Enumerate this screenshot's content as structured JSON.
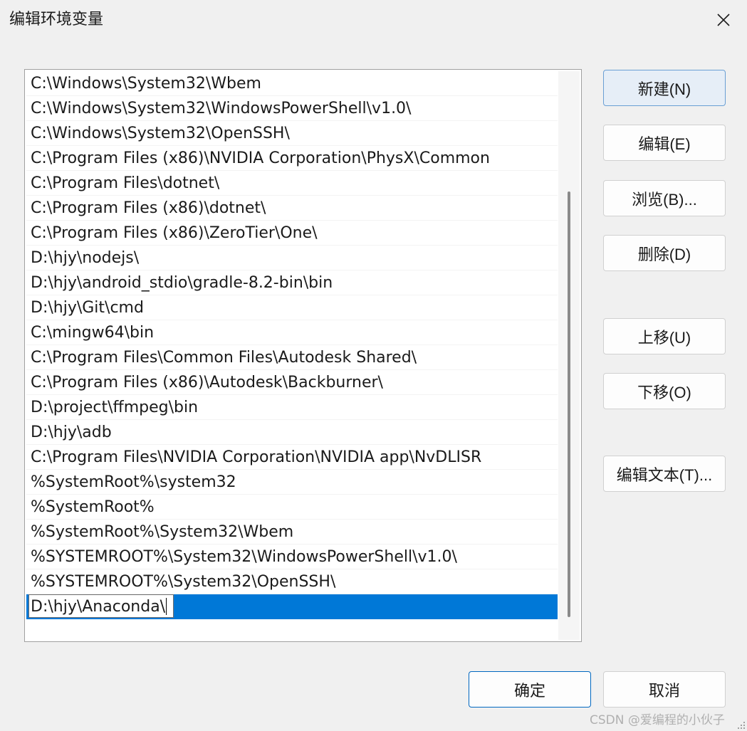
{
  "window": {
    "title": "编辑环境变量"
  },
  "paths": [
    "C:\\Windows\\System32\\Wbem",
    "C:\\Windows\\System32\\WindowsPowerShell\\v1.0\\",
    "C:\\Windows\\System32\\OpenSSH\\",
    "C:\\Program Files (x86)\\NVIDIA Corporation\\PhysX\\Common",
    "C:\\Program Files\\dotnet\\",
    "C:\\Program Files (x86)\\dotnet\\",
    "C:\\Program Files (x86)\\ZeroTier\\One\\",
    "D:\\hjy\\nodejs\\",
    "D:\\hjy\\android_stdio\\gradle-8.2-bin\\bin",
    "D:\\hjy\\Git\\cmd",
    "C:\\mingw64\\bin",
    "C:\\Program Files\\Common Files\\Autodesk Shared\\",
    "C:\\Program Files (x86)\\Autodesk\\Backburner\\",
    "D:\\project\\ffmpeg\\bin",
    "D:\\hjy\\adb",
    "C:\\Program Files\\NVIDIA Corporation\\NVIDIA app\\NvDLISR",
    "%SystemRoot%\\system32",
    "%SystemRoot%",
    "%SystemRoot%\\System32\\Wbem",
    "%SYSTEMROOT%\\System32\\WindowsPowerShell\\v1.0\\",
    "%SYSTEMROOT%\\System32\\OpenSSH\\"
  ],
  "editing": {
    "value": "D:\\hjy\\Anaconda\\"
  },
  "buttons": {
    "new": "新建(N)",
    "edit": "编辑(E)",
    "browse": "浏览(B)...",
    "delete": "删除(D)",
    "move_up": "上移(U)",
    "move_down": "下移(O)",
    "edit_text": "编辑文本(T)...",
    "ok": "确定",
    "cancel": "取消"
  },
  "watermark": "CSDN @爱编程的小伙子",
  "colors": {
    "selection": "#0078d7",
    "background": "#f0f0f0"
  }
}
